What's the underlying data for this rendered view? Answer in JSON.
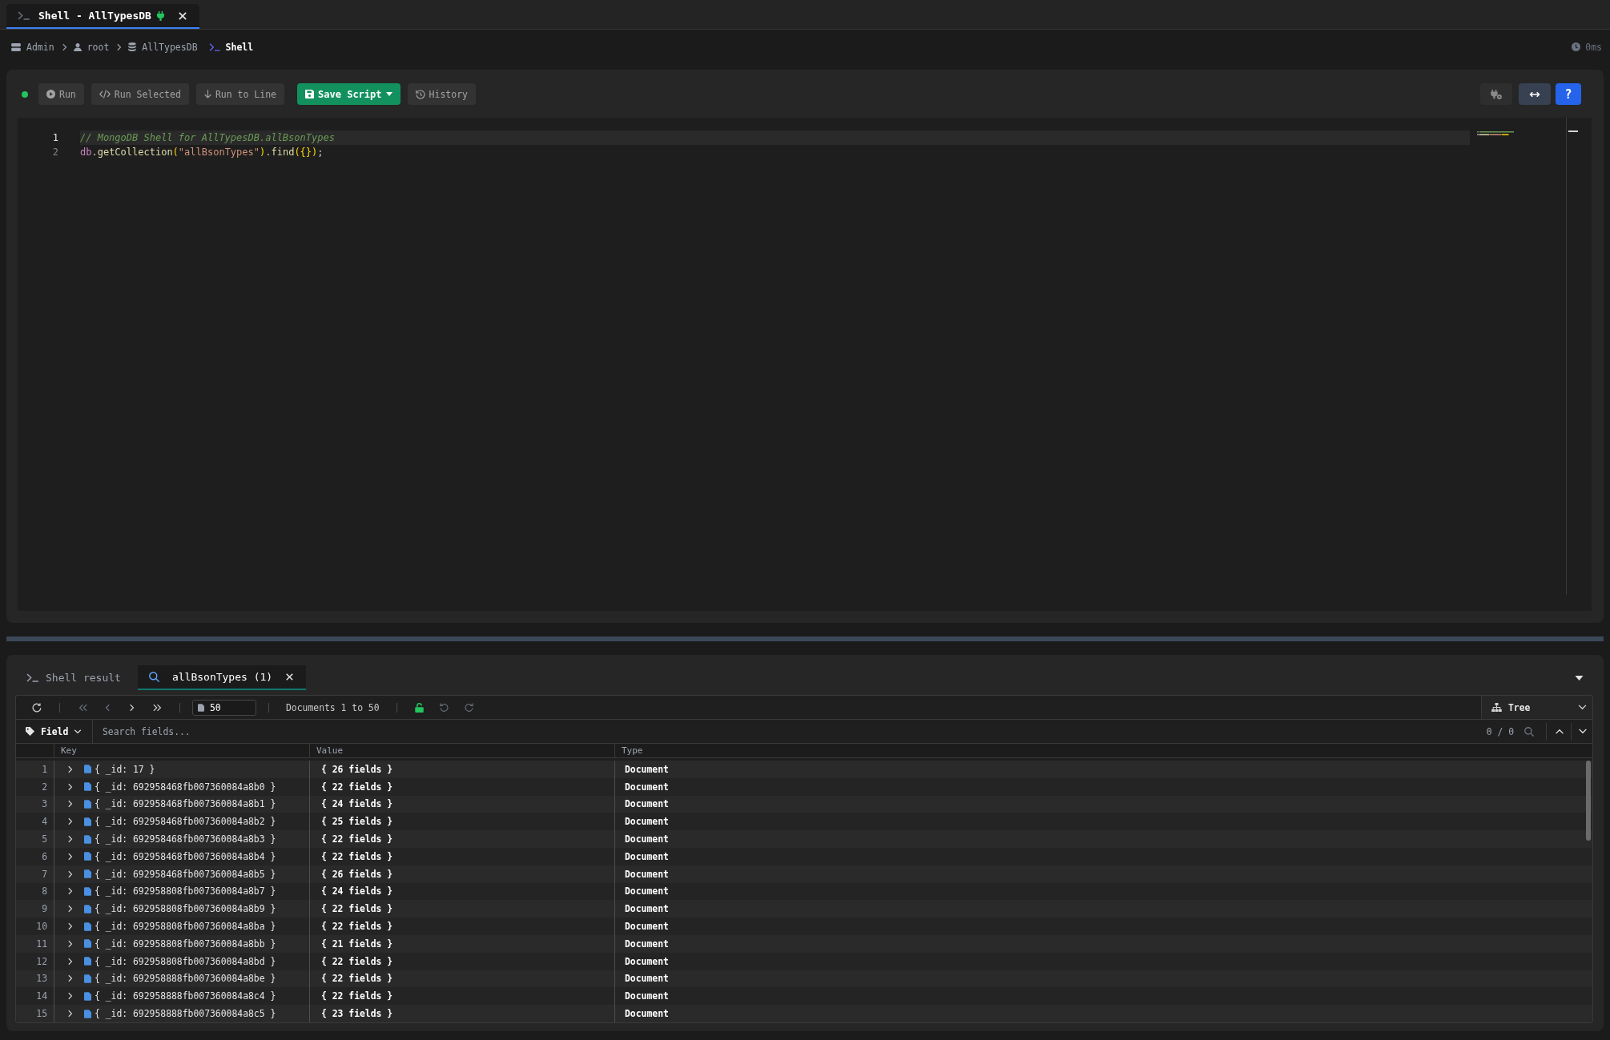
{
  "tabs": [
    {
      "label": "Shell - AllTypesDB",
      "selected": true,
      "connected": true
    }
  ],
  "breadcrumb": {
    "items": [
      {
        "kind": "server",
        "label": "Admin",
        "current": false
      },
      {
        "kind": "user",
        "label": "root",
        "current": false
      },
      {
        "kind": "database",
        "label": "AllTypesDB",
        "current": false
      },
      {
        "kind": "shell",
        "label": "Shell",
        "current": true
      }
    ],
    "elapsed": "0ms"
  },
  "editor": {
    "connected": true,
    "actions": [
      {
        "kind": "run",
        "label": "Run",
        "has_menu": false
      },
      {
        "kind": "run-selected",
        "label": "Run Selected",
        "has_menu": false
      },
      {
        "kind": "run-to-line",
        "label": "Run to Line",
        "has_menu": false
      },
      {
        "kind": "save",
        "label": "Save Script",
        "has_menu": true
      },
      {
        "kind": "history",
        "label": "History",
        "has_menu": false
      }
    ],
    "tools": [
      {
        "kind": "plug-settings"
      },
      {
        "kind": "swap"
      },
      {
        "kind": "help",
        "label": "?"
      }
    ],
    "lines": [
      {
        "number": "1",
        "active": true,
        "tokens": [
          {
            "kind": "comment",
            "text": "// MongoDB Shell for AllTypesDB.allBsonTypes"
          }
        ]
      },
      {
        "number": "2",
        "active": false,
        "tokens": [
          {
            "kind": "variable",
            "text": "db"
          },
          {
            "kind": "punctuation",
            "text": "."
          },
          {
            "kind": "function",
            "text": "getCollection"
          },
          {
            "kind": "bracket",
            "text": "("
          },
          {
            "kind": "string",
            "text": "\"allBsonTypes\""
          },
          {
            "kind": "bracket",
            "text": ")"
          },
          {
            "kind": "punctuation",
            "text": "."
          },
          {
            "kind": "function",
            "text": "find"
          },
          {
            "kind": "bracket",
            "text": "({})"
          },
          {
            "kind": "punctuation",
            "text": ";"
          }
        ]
      }
    ]
  },
  "results": {
    "tabs": [
      {
        "kind": "shell",
        "label": "Shell result",
        "selected": false,
        "closable": false
      },
      {
        "kind": "query",
        "label": "allBsonTypes (1)",
        "selected": true,
        "closable": true
      }
    ],
    "pager": {
      "page_size": "50",
      "range": "Documents 1 to 50",
      "locked": false
    },
    "view_mode": "Tree",
    "filter": {
      "field": "Field",
      "placeholder": "Search fields...",
      "match_count": "0 / 0"
    },
    "table": {
      "columns": [
        "Key",
        "Value",
        "Type"
      ],
      "rows": [
        {
          "number": "1",
          "key": "{ _id: 17 }",
          "value": "{ 26 fields }",
          "type": "Document",
          "expanded": false
        },
        {
          "number": "2",
          "key": "{ _id: 692958468fb007360084a8b0 }",
          "value": "{ 22 fields }",
          "type": "Document",
          "expanded": false
        },
        {
          "number": "3",
          "key": "{ _id: 692958468fb007360084a8b1 }",
          "value": "{ 24 fields }",
          "type": "Document",
          "expanded": false
        },
        {
          "number": "4",
          "key": "{ _id: 692958468fb007360084a8b2 }",
          "value": "{ 25 fields }",
          "type": "Document",
          "expanded": false
        },
        {
          "number": "5",
          "key": "{ _id: 692958468fb007360084a8b3 }",
          "value": "{ 22 fields }",
          "type": "Document",
          "expanded": false
        },
        {
          "number": "6",
          "key": "{ _id: 692958468fb007360084a8b4 }",
          "value": "{ 22 fields }",
          "type": "Document",
          "expanded": false
        },
        {
          "number": "7",
          "key": "{ _id: 692958468fb007360084a8b5 }",
          "value": "{ 26 fields }",
          "type": "Document",
          "expanded": false
        },
        {
          "number": "8",
          "key": "{ _id: 692958808fb007360084a8b7 }",
          "value": "{ 24 fields }",
          "type": "Document",
          "expanded": false
        },
        {
          "number": "9",
          "key": "{ _id: 692958808fb007360084a8b9 }",
          "value": "{ 22 fields }",
          "type": "Document",
          "expanded": false
        },
        {
          "number": "10",
          "key": "{ _id: 692958808fb007360084a8ba }",
          "value": "{ 22 fields }",
          "type": "Document",
          "expanded": false
        },
        {
          "number": "11",
          "key": "{ _id: 692958808fb007360084a8bb }",
          "value": "{ 21 fields }",
          "type": "Document",
          "expanded": false
        },
        {
          "number": "12",
          "key": "{ _id: 692958808fb007360084a8bd }",
          "value": "{ 22 fields }",
          "type": "Document",
          "expanded": false
        },
        {
          "number": "13",
          "key": "{ _id: 692958888fb007360084a8be }",
          "value": "{ 22 fields }",
          "type": "Document",
          "expanded": false
        },
        {
          "number": "14",
          "key": "{ _id: 692958888fb007360084a8c4 }",
          "value": "{ 22 fields }",
          "type": "Document",
          "expanded": false
        },
        {
          "number": "15",
          "key": "{ _id: 692958888fb007360084a8c5 }",
          "value": "{ 23 fields }",
          "type": "Document",
          "expanded": false
        }
      ]
    }
  }
}
